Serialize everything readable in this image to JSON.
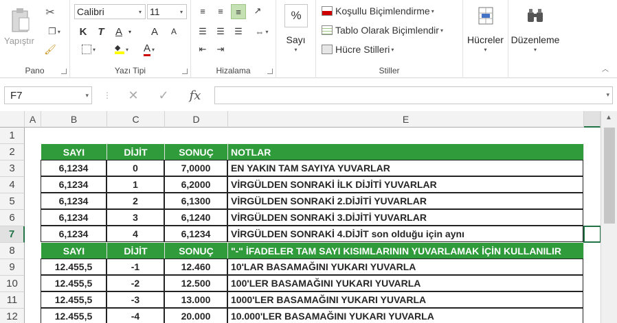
{
  "ribbon": {
    "pano": {
      "paste_label": "Yapıştır",
      "group_label": "Pano"
    },
    "font": {
      "name": "Calibri",
      "size": "11",
      "bold": "K",
      "italic": "T",
      "underline": "A",
      "grow": "A",
      "shrink": "A",
      "fontcolor": "A",
      "group_label": "Yazı Tipi"
    },
    "align": {
      "group_label": "Hizalama"
    },
    "number": {
      "label": "Sayı",
      "symbol": "%"
    },
    "styles": {
      "conditional": "Koşullu Biçimlendirme",
      "table": "Tablo Olarak Biçimlendir",
      "cell": "Hücre Stilleri",
      "group_label": "Stiller"
    },
    "cells": {
      "label": "Hücreler"
    },
    "editing": {
      "label": "Düzenleme"
    }
  },
  "formula_bar": {
    "name_box": "F7",
    "cancel": "✕",
    "enter": "✓",
    "fx": "fx",
    "value": ""
  },
  "columns": [
    "A",
    "B",
    "C",
    "D",
    "E"
  ],
  "rows": [
    "1",
    "2",
    "3",
    "4",
    "5",
    "6",
    "7",
    "8",
    "9",
    "10",
    "11",
    "12"
  ],
  "header1": [
    "SAYI",
    "DİJİT",
    "SONUÇ",
    "NOTLAR"
  ],
  "table1": [
    [
      "6,1234",
      "0",
      "7,0000",
      "EN YAKIN TAM SAYIYA YUVARLAR"
    ],
    [
      "6,1234",
      "1",
      "6,2000",
      "VİRGÜLDEN SONRAKİ İLK DİJİTİ YUVARLAR"
    ],
    [
      "6,1234",
      "2",
      "6,1300",
      "VİRGÜLDEN SONRAKİ 2.DİJİTİ YUVARLAR"
    ],
    [
      "6,1234",
      "3",
      "6,1240",
      "VİRGÜLDEN SONRAKİ 3.DİJİTİ YUVARLAR"
    ],
    [
      "6,1234",
      "4",
      "6,1234",
      "VİRGÜLDEN SONRAKİ 4.DİJİT son olduğu için aynı"
    ]
  ],
  "header2": [
    "SAYI",
    "DİJİT",
    "SONUÇ",
    "\"-\" İFADELER TAM SAYI KISIMLARININ YUVARLAMAK İÇİN KULLANILIR"
  ],
  "table2": [
    [
      "12.455,5",
      "-1",
      "12.460",
      "10'LAR BASAMAĞINI YUKARI YUVARLA"
    ],
    [
      "12.455,5",
      "-2",
      "12.500",
      "100'LER BASAMAĞINI YUKARI YUVARLA"
    ],
    [
      "12.455,5",
      "-3",
      "13.000",
      "1000'LER BASAMAĞINI YUKARI YUVARLA"
    ],
    [
      "12.455,5",
      "-4",
      "20.000",
      "10.000'LER BASAMAĞINI YUKARI YUVARLA"
    ]
  ],
  "colors": {
    "header_green": "#2f9b3b",
    "accent": "#217346"
  }
}
